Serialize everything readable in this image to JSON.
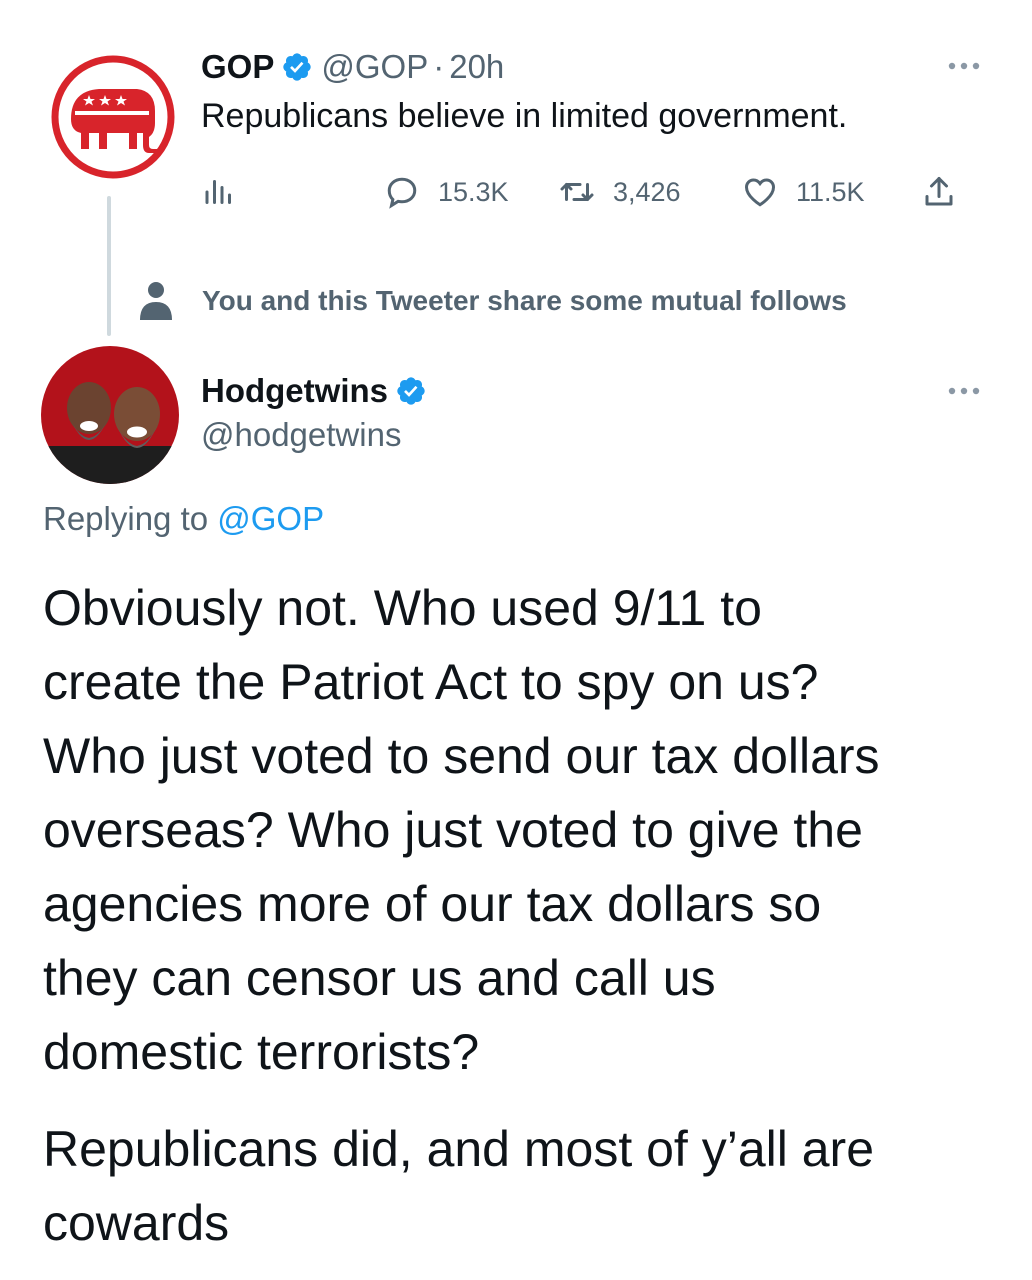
{
  "original_tweet": {
    "author_name": "GOP",
    "handle": "@GOP",
    "separator": "·",
    "time": "20h",
    "text": "Republicans believe in limited government.",
    "replies": "15.3K",
    "retweets": "3,426",
    "likes": "11.5K",
    "brand_color": "#d8242b"
  },
  "mutual_follows": {
    "text": "You and this Tweeter share some mutual follows"
  },
  "reply_tweet": {
    "author_name": "Hodgetwins",
    "handle": "@hodgetwins",
    "replying_prefix": "Replying to ",
    "replying_to": "@GOP",
    "paragraph_1": "Obviously not. Who used 9/11 to\ncreate the Patriot Act to spy on us?\nWho just voted to send our tax dollars\noverseas? Who just voted to give the\nagencies more of our tax dollars so\nthey can censor us and call us\ndomestic terrorists?",
    "paragraph_2": "Republicans did, and most of y’all are\ncowards"
  },
  "colors": {
    "accent": "#1d9bf0",
    "muted": "#536471",
    "text": "#0f1419",
    "avatar_bg": "#b3121b"
  }
}
